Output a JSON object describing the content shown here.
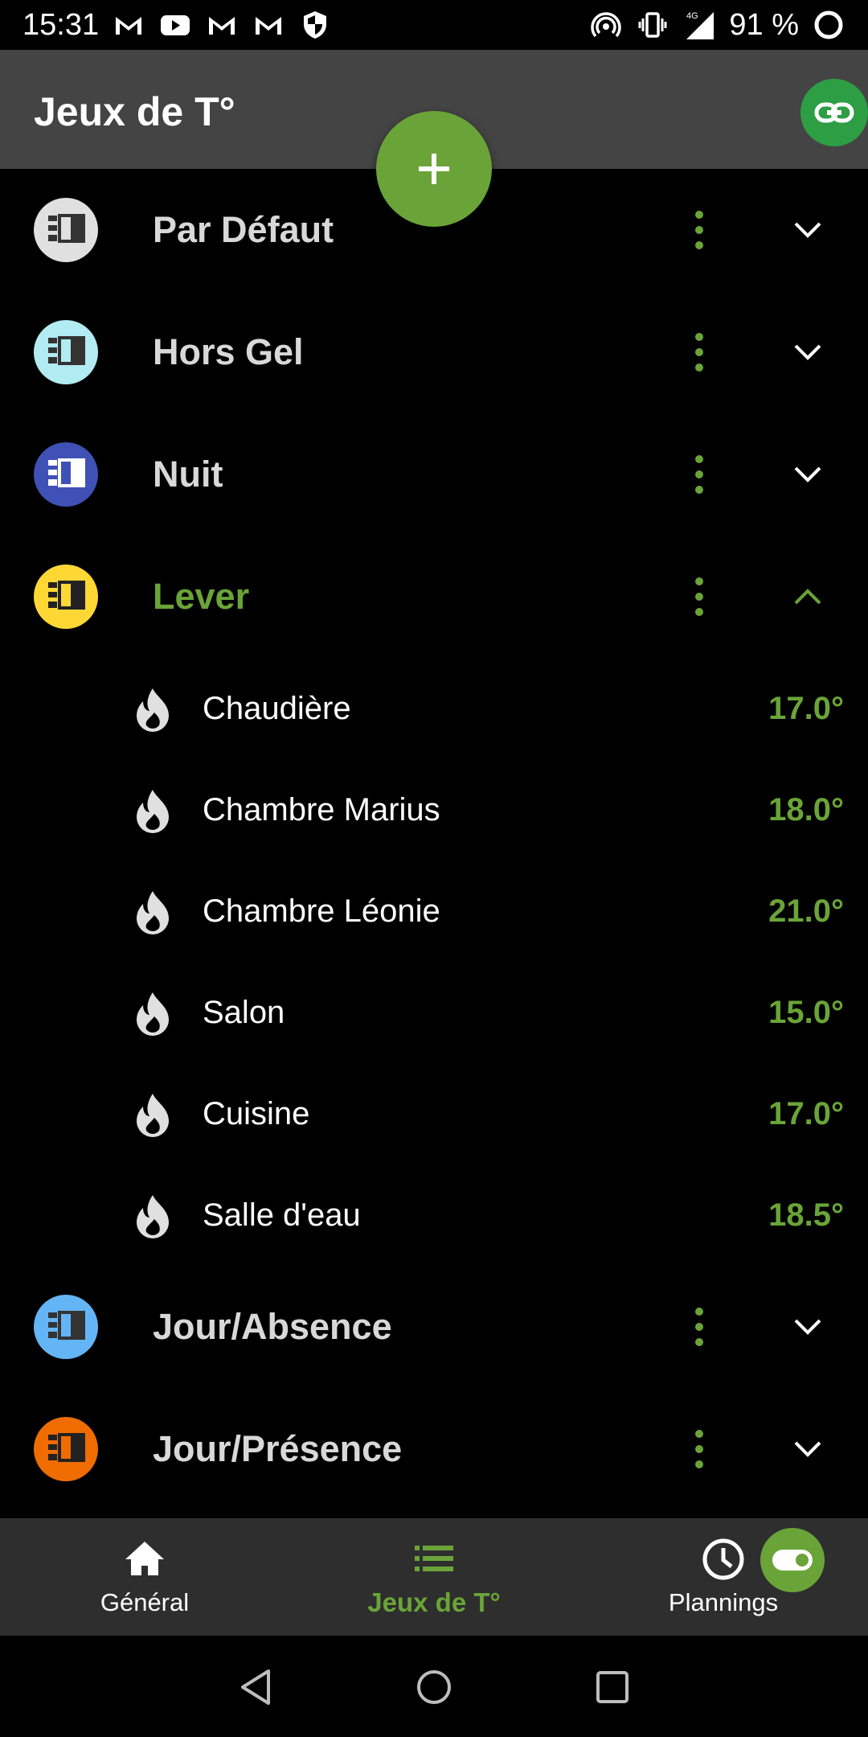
{
  "status_bar": {
    "time": "15:31",
    "battery": "91 %",
    "network": "4G",
    "left_icons": [
      "gmail-icon",
      "youtube-icon",
      "gmail-icon",
      "gmail-icon",
      "shield-icon"
    ],
    "right_icons": [
      "hotspot-icon",
      "vibrate-icon",
      "signal-icon",
      "battery-ring-icon"
    ]
  },
  "app_bar": {
    "title": "Jeux de T°"
  },
  "colors": {
    "accent": "#6aa438",
    "link_fab": "#2e9e44",
    "appbar": "#444444",
    "bottomnav": "#2e2e2e"
  },
  "groups": [
    {
      "label": "Par Défaut",
      "icon_color": "#e0e0e0",
      "expanded": false
    },
    {
      "label": "Hors Gel",
      "icon_color": "#b2ebf2",
      "expanded": false
    },
    {
      "label": "Nuit",
      "icon_color": "#3f51b5",
      "expanded": false
    },
    {
      "label": "Lever",
      "icon_color": "#fdd835",
      "expanded": true
    },
    {
      "label": "Jour/Absence",
      "icon_color": "#64b5f6",
      "expanded": false
    },
    {
      "label": "Jour/Présence",
      "icon_color": "#ef6c00",
      "expanded": false
    }
  ],
  "lever_zones": [
    {
      "name": "Chaudière",
      "temp": "17.0°"
    },
    {
      "name": "Chambre Marius",
      "temp": "18.0°"
    },
    {
      "name": "Chambre Léonie",
      "temp": "21.0°"
    },
    {
      "name": "Salon",
      "temp": "15.0°"
    },
    {
      "name": "Cuisine",
      "temp": "17.0°"
    },
    {
      "name": "Salle d'eau",
      "temp": "18.5°"
    }
  ],
  "bottom_nav": [
    {
      "label": "Général",
      "icon": "home-icon",
      "active": false
    },
    {
      "label": "Jeux de T°",
      "icon": "list-icon",
      "active": true
    },
    {
      "label": "Plannings",
      "icon": "clock-icon",
      "active": false
    }
  ]
}
